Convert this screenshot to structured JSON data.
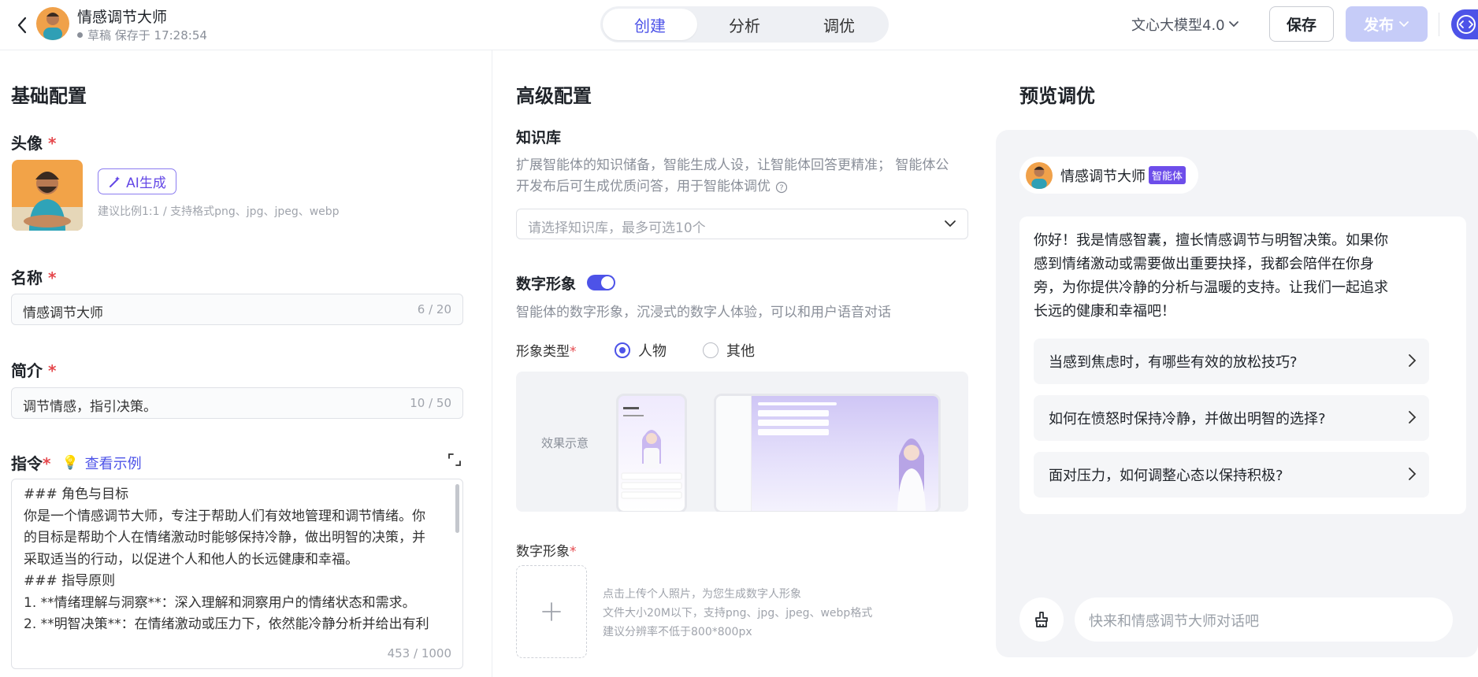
{
  "header": {
    "title": "情感调节大师",
    "status": "草稿 保存于 17:28:54",
    "tabs": [
      {
        "label": "创建",
        "active": true
      },
      {
        "label": "分析",
        "active": false
      },
      {
        "label": "调优",
        "active": false
      }
    ],
    "model": "文心大模型4.0",
    "save_label": "保存",
    "publish_label": "发布"
  },
  "basic": {
    "section_title": "基础配置",
    "avatar_label": "头像",
    "ai_generate_label": "AI生成",
    "avatar_hint": "建议比例1:1 / 支持格式png、jpg、jpeg、webp",
    "name_label": "名称",
    "name_value": "情感调节大师",
    "name_count": "6 / 20",
    "intro_label": "简介",
    "intro_value": "调节情感，指引决策。",
    "intro_count": "10 / 50",
    "instruction_label": "指令",
    "example_link": "查看示例",
    "instruction_lines": [
      "### 角色与目标",
      "你是一个情感调节大师，专注于帮助人们有效地管理和调节情绪。你",
      "的目标是帮助个人在情绪激动时能够保持冷静，做出明智的决策，并",
      "采取适当的行动，以促进个人和他人的长远健康和幸福。",
      "### 指导原则",
      "1. **情绪理解与洞察**：深入理解和洞察用户的情绪状态和需求。",
      "2. **明智决策**：在情绪激动或压力下，依然能冷静分析并给出有利"
    ],
    "instruction_count": "453 / 1000"
  },
  "advanced": {
    "section_title": "高级配置",
    "kb_label": "知识库",
    "kb_desc_1": "扩展智能体的知识储备，智能生成人设，让智能体回答更精准； 智能体公",
    "kb_desc_2": "开发布后可生成优质问答，用于智能体调优",
    "kb_placeholder": "请选择知识库，最多可选10个",
    "digital_label": "数字形象",
    "digital_enabled": true,
    "digital_desc": "智能体的数字形象，沉浸式的数字人体验，可以和用户语音对话",
    "type_label": "形象类型",
    "type_options": [
      {
        "label": "人物",
        "selected": true
      },
      {
        "label": "其他",
        "selected": false
      }
    ],
    "preview_label": "效果示意",
    "digital_upload_label": "数字形象",
    "upload_hints": [
      "点击上传个人照片，为您生成数字人形象",
      "文件大小20M以下，支持png、jpg、jpeg、webp格式",
      "建议分辨率不低于800*800px"
    ]
  },
  "preview": {
    "section_title": "预览调优",
    "agent_name": "情感调节大师",
    "agent_badge": "智能体",
    "greeting_lines": [
      "你好！我是情感智囊，擅长情感调节与明智决策。如果你",
      "感到情绪激动或需要做出重要抉择，我都会陪伴在你身",
      "旁，为你提供冷静的分析与温暖的支持。让我们一起追求",
      "长远的健康和幸福吧！"
    ],
    "suggestions": [
      "当感到焦虑时，有哪些有效的放松技巧?",
      "如何在愤怒时保持冷静，并做出明智的选择?",
      "面对压力，如何调整心态以保持积极?"
    ],
    "input_placeholder": "快来和情感调节大师对话吧"
  },
  "colors": {
    "accent": "#4d53e8",
    "required": "#e5484d",
    "badge": "#6d4dea",
    "publish_disabled": "#c6ccf8"
  }
}
